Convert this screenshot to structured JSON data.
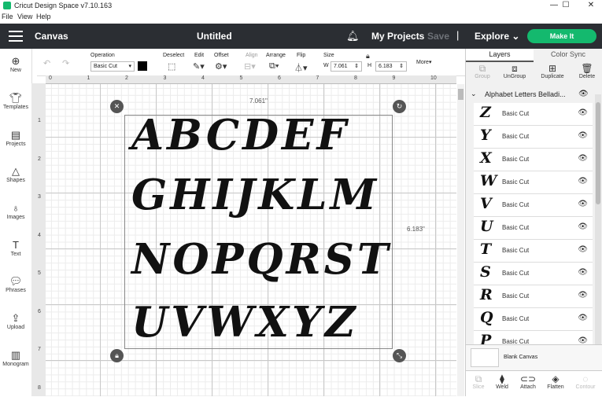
{
  "window": {
    "title": "Cricut Design Space  v7.10.163",
    "controls": [
      "—",
      "☐",
      "✕"
    ]
  },
  "menubar": [
    "File",
    "View",
    "Help"
  ],
  "header": {
    "section": "Canvas",
    "project_title": "Untitled",
    "my_projects": "My Projects",
    "save": "Save",
    "separator": "|",
    "explore": "Explore",
    "make_it": "Make It",
    "accent_color": "#14b96e",
    "bg_color": "#2b2e33"
  },
  "sidebar": {
    "items": [
      {
        "label": "New",
        "icon": "plus-circle-icon"
      },
      {
        "label": "Templates",
        "icon": "shirt-icon"
      },
      {
        "label": "Projects",
        "icon": "clipboard-icon"
      },
      {
        "label": "Shapes",
        "icon": "shapes-icon"
      },
      {
        "label": "Images",
        "icon": "lightbulb-icon"
      },
      {
        "label": "Text",
        "icon": "text-icon"
      },
      {
        "label": "Phrases",
        "icon": "speech-bubble-icon"
      },
      {
        "label": "Upload",
        "icon": "upload-icon"
      },
      {
        "label": "Monogram",
        "icon": "monogram-icon"
      }
    ]
  },
  "toolbar": {
    "operation_label": "Operation",
    "operation_value": "Basic Cut",
    "deselect": "Deselect",
    "edit": "Edit",
    "offset": "Offset",
    "align": "Align",
    "arrange": "Arrange",
    "flip": "Flip",
    "size": "Size",
    "w_label": "W",
    "w_value": "7.061",
    "h_label": "H",
    "h_value": "6.183",
    "more": "More▾"
  },
  "ruler": {
    "top_ticks": [
      "0",
      "1",
      "2",
      "3",
      "4",
      "5",
      "6",
      "7",
      "8",
      "9",
      "10"
    ],
    "left_ticks": [
      "1",
      "2",
      "3",
      "4",
      "5",
      "6",
      "7",
      "8"
    ]
  },
  "canvas": {
    "width_readout": "7.061\"",
    "height_readout": "6.183\"",
    "rows": [
      "ABCDEF",
      "GHIJKLM",
      "NOPQRST",
      "UVWXYZ"
    ]
  },
  "panel": {
    "tabs": [
      "Layers",
      "Color Sync"
    ],
    "tools": [
      "Group",
      "UnGroup",
      "Duplicate",
      "Delete"
    ],
    "group_name": "Alphabet Letters Belladi...",
    "layers": [
      {
        "glyph": "Z",
        "name": "Basic Cut"
      },
      {
        "glyph": "Y",
        "name": "Basic Cut"
      },
      {
        "glyph": "X",
        "name": "Basic Cut"
      },
      {
        "glyph": "W",
        "name": "Basic Cut"
      },
      {
        "glyph": "V",
        "name": "Basic Cut"
      },
      {
        "glyph": "U",
        "name": "Basic Cut"
      },
      {
        "glyph": "T",
        "name": "Basic Cut"
      },
      {
        "glyph": "S",
        "name": "Basic Cut"
      },
      {
        "glyph": "R",
        "name": "Basic Cut"
      },
      {
        "glyph": "Q",
        "name": "Basic Cut"
      },
      {
        "glyph": "P",
        "name": "Basic Cut"
      }
    ],
    "blank_canvas": "Blank Canvas",
    "bottom_tools": [
      "Slice",
      "Weld",
      "Attach",
      "Flatten",
      "Contour"
    ]
  }
}
